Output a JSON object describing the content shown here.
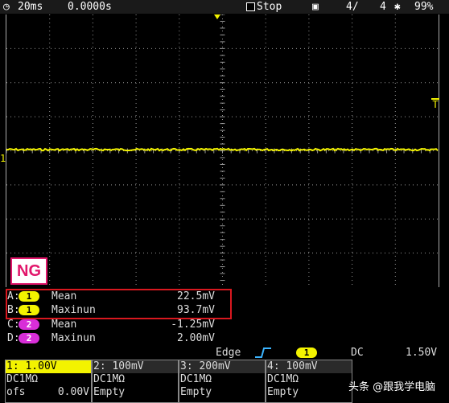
{
  "status": {
    "timebase": "20ms",
    "offset": "0.0000s",
    "run_state": "Stop",
    "page": "4/",
    "count": "4",
    "battery": "99%"
  },
  "colors": {
    "trace": "#f3f300",
    "ch2": "#d82ed8",
    "highlight": "#d8181f",
    "ng": "#e2166b",
    "trigger_cursor": "#f3f300"
  },
  "markers": {
    "trigger_level": "T",
    "ch1_ground": "1"
  },
  "ng_badge": "NG",
  "measurements": [
    {
      "slot": "A:",
      "channel": "1",
      "name": "Mean",
      "value": "22.5mV"
    },
    {
      "slot": "B:",
      "channel": "1",
      "name": "Maxinun",
      "value": "93.7mV"
    },
    {
      "slot": "C:",
      "channel": "2",
      "name": "Mean",
      "value": "-1.25mV"
    },
    {
      "slot": "D:",
      "channel": "2",
      "name": "Maxinun",
      "value": "2.00mV"
    }
  ],
  "trigger": {
    "type": "Edge",
    "edge_icon": "rising-edge-icon",
    "source": "1",
    "coupling": "DC",
    "level": "1.50V"
  },
  "channels": [
    {
      "header": "1: 1.00V",
      "line1": "DC1MΩ",
      "line2_left": "ofs",
      "line2_right": "0.00V"
    },
    {
      "header": "2: 100mV",
      "line1": "DC1MΩ",
      "line2_left": "Empty",
      "line2_right": ""
    },
    {
      "header": "3: 200mV",
      "line1": "DC1MΩ",
      "line2_left": "Empty",
      "line2_right": ""
    },
    {
      "header": "4: 100mV",
      "line1": "DC1MΩ",
      "line2_left": "Empty",
      "line2_right": ""
    }
  ],
  "watermark": "头条 @跟我学电脑"
}
